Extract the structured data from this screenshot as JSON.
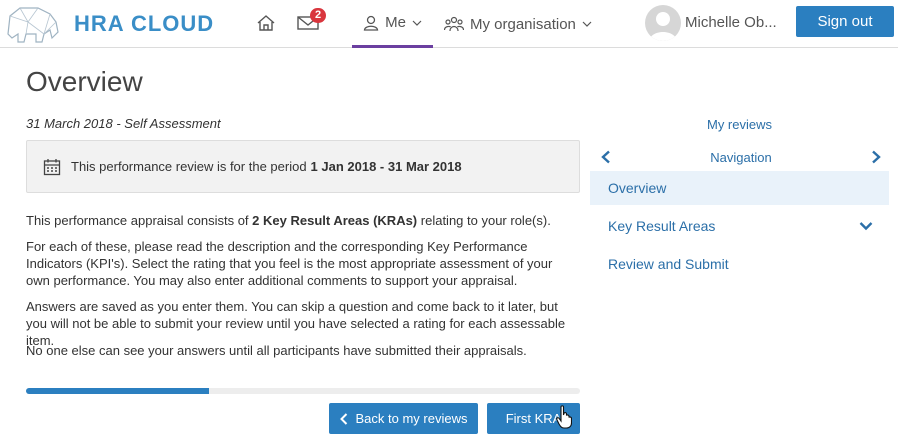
{
  "header": {
    "logo_text": "HRA CLOUD",
    "logo_mark": "hra-elephant-logo",
    "home_icon": "home-icon",
    "mail_icon": "mail-icon",
    "notification_count": "2",
    "me_label": "Me",
    "org_label": "My organisation",
    "user_name": "Michelle Ob...",
    "sign_out_label": "Sign out"
  },
  "main": {
    "title": "Overview",
    "subtitle": "31 March 2018 - Self Assessment",
    "period_text": "This performance review is for the period",
    "period_range": "1 Jan 2018 - 31 Mar 2018",
    "p1_before": "This performance appraisal consists of",
    "p1_bold": "2 Key Result Areas (KRAs)",
    "p1_after": "relating to your role(s).",
    "p2": "For each of these, please read the description and the corresponding Key Performance Indicators (KPI's). Select the rating that you feel is the most appropriate assessment of your own performance. You may also enter additional comments to support your appraisal.",
    "p3": "Answers are saved as you enter them. You can skip a question and come back to it later, but you will not be able to submit your review until you have selected a rating for each assessable item.",
    "p4": "No one else can see your answers until all participants have submitted their appraisals.",
    "progress_fraction": 0.33,
    "back_button": "Back to my reviews",
    "next_button": "First KRA"
  },
  "sidebar": {
    "my_reviews": "My reviews",
    "navigation": "Navigation",
    "items": [
      {
        "label": "Overview",
        "active": true
      },
      {
        "label": "Key Result Areas",
        "expandable": true
      },
      {
        "label": "Review and Submit"
      }
    ]
  },
  "colors": {
    "accent": "#2b7fc0",
    "link": "#2b6fa8",
    "active_tab": "#6b3fa0",
    "badge": "#d9363e"
  }
}
